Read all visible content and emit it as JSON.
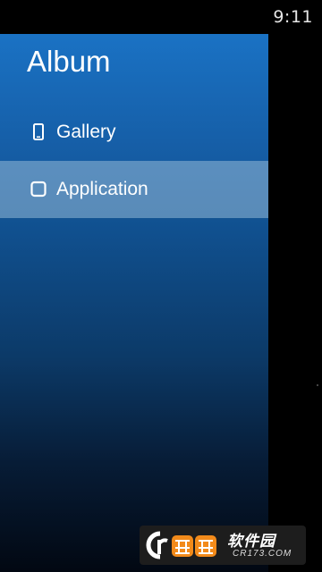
{
  "status_bar": {
    "time": "9:11"
  },
  "drawer": {
    "title": "Album",
    "items": [
      {
        "label": "Gallery",
        "icon": "phone-icon",
        "selected": false
      },
      {
        "label": "Application",
        "icon": "app-square-icon",
        "selected": true
      }
    ]
  },
  "watermark": {
    "logo_text": "CrOO",
    "title": "软件园",
    "subtitle": "CR173.COM"
  },
  "colors": {
    "drawer_top": "#1a72c4",
    "drawer_bottom": "#020812",
    "selected_item_bg": "#96b9d7",
    "text": "#ffffff",
    "background": "#000000"
  }
}
